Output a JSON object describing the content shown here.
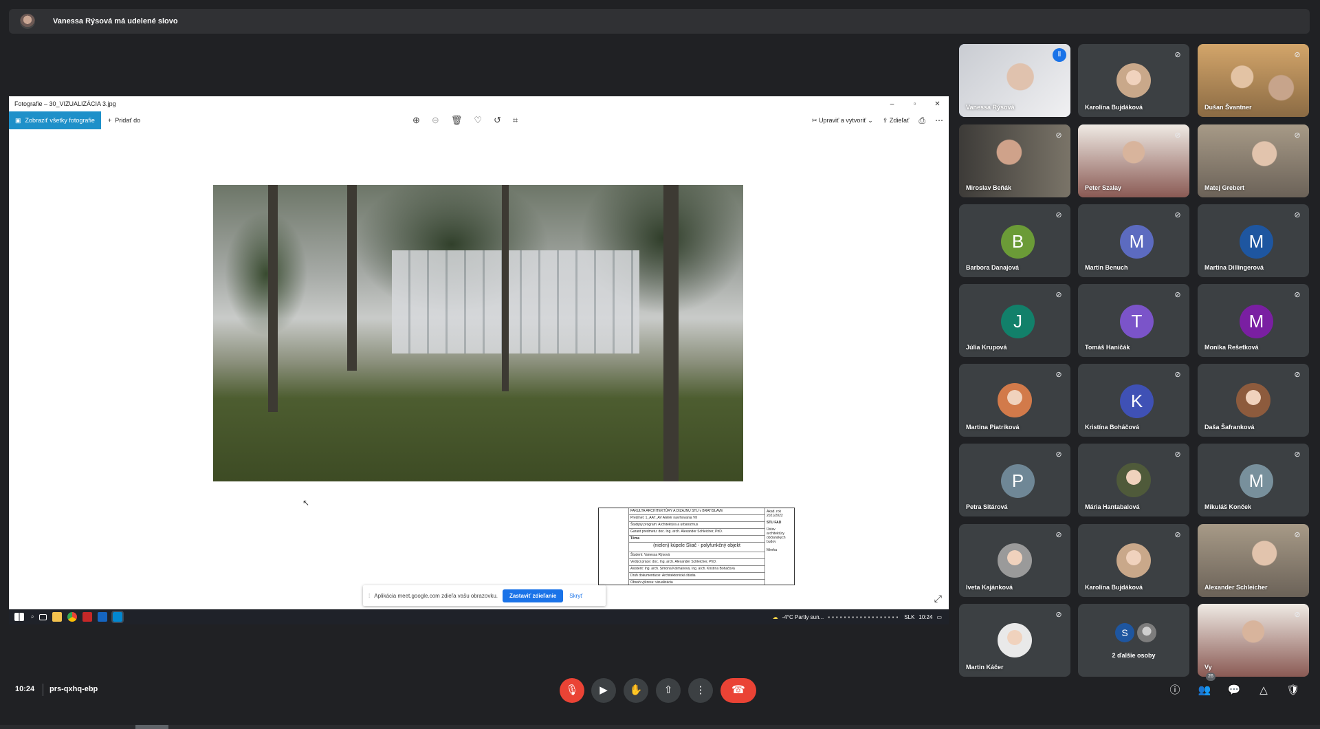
{
  "banner": {
    "text": "Vanessa Rýsová má udelené slovo"
  },
  "window": {
    "title": "Fotografie – 30_VIZUALIZÁCIA 3.jpg",
    "btn_minimize": "–",
    "btn_restore": "▫",
    "btn_close": "✕",
    "show_all_label": "Zobraziť všetky fotografie",
    "add_to_label": "Pridať do",
    "tools": [
      "zoom-in-icon",
      "zoom-out-icon",
      "delete-icon",
      "heart-icon",
      "rotate-icon",
      "crop-icon"
    ],
    "edit_label": "Upraviť a vytvoriť",
    "share_label": "Zdieľať"
  },
  "titleblock": {
    "rows": [
      "FAKULTA ARCHITEKTÚRY A DIZAJNU STU v BRATISLAVE",
      "Predmet: 1_AAT_AV Ateliér navrhovania VII",
      "Študijný program: Architektúra a urbanizmus",
      "Garant predmetu: doc. Ing. arch. Alexander Schleicher, PhD.",
      "Téma",
      "(nielen) kúpele Sliač - polyfunkčný objekt",
      "Študent: Vanessa Rýsová",
      "Vedúci práce: doc. Ing. arch. Alexander Schleicher, PhD.",
      "Asistent: Ing. arch. Simona Kolmanová, Ing. arch. Kristína Bohačová",
      "Druh dokumentácie: Architektonická štúdia",
      "Obsah výkresu: vizualizácia"
    ],
    "year": "Akad. rok 2021/2022",
    "logo": "STU FAD",
    "institute": "Ústav architektúry občianskych budov",
    "mark": "Mierka"
  },
  "sharebar": {
    "text": "Aplikácia meet.google.com zdieľa vašu obrazovku.",
    "stop_label": "Zastaviť zdieľanie",
    "hide_label": "Skryť"
  },
  "taskbar": {
    "weather": "-4°C  Partly sun...",
    "lang": "SLK",
    "time": "10:24"
  },
  "participants": [
    {
      "name": "Vanessa Rýsová",
      "type": "video",
      "speaking": true
    },
    {
      "name": "Karolína Bujdáková",
      "type": "photo",
      "color": "#c9a88a"
    },
    {
      "name": "Dušan Švantner",
      "type": "video"
    },
    {
      "name": "Miroslav Beňák",
      "type": "video"
    },
    {
      "name": "Peter Szalay",
      "type": "video"
    },
    {
      "name": "Matej Grebert",
      "type": "video"
    },
    {
      "name": "Barbora Danajová",
      "type": "letter",
      "letter": "B",
      "color": "#6b9b37"
    },
    {
      "name": "Martin Benuch",
      "type": "letter",
      "letter": "M",
      "color": "#5c6bc0"
    },
    {
      "name": "Martina Dillingerová",
      "type": "letter",
      "letter": "M",
      "color": "#1e56a0"
    },
    {
      "name": "Júlia Krupová",
      "type": "letter",
      "letter": "J",
      "color": "#12806a"
    },
    {
      "name": "Tomáš Haničák",
      "type": "letter",
      "letter": "T",
      "color": "#7b54c9"
    },
    {
      "name": "Monika Rešetková",
      "type": "letter",
      "letter": "M",
      "color": "#7a1fa2"
    },
    {
      "name": "Martina Piatriková",
      "type": "photo",
      "color": "#d27a4a"
    },
    {
      "name": "Kristína Boháčová",
      "type": "letter",
      "letter": "K",
      "color": "#3f51b5"
    },
    {
      "name": "Daša Šafranková",
      "type": "photo",
      "color": "#8d5b3d"
    },
    {
      "name": "Petra Sitárová",
      "type": "letter",
      "letter": "P",
      "color": "#6f8796"
    },
    {
      "name": "Mária Hantabalová",
      "type": "photo",
      "color": "#4f5a3a"
    },
    {
      "name": "Mikuláš Konček",
      "type": "letter",
      "letter": "M",
      "color": "#78909c"
    },
    {
      "name": "Iveta Kajánková",
      "type": "photo",
      "color": "#9a9a9a"
    },
    {
      "name": "Karolína Bujdáková",
      "type": "photo",
      "color": "#c9a88a"
    },
    {
      "name": "Alexander Schleicher",
      "type": "video"
    },
    {
      "name": "Martin Káčer",
      "type": "photo",
      "color": "#e9e9e9"
    },
    {
      "name": "",
      "type": "more",
      "more_text": "2 ďalšie osoby",
      "letter": "S",
      "color": "#1e56a0"
    },
    {
      "name": "Vy",
      "type": "video"
    }
  ],
  "controls": {
    "time": "10:24",
    "meeting_code": "prs-qxhq-ebp",
    "people_count": "26"
  }
}
